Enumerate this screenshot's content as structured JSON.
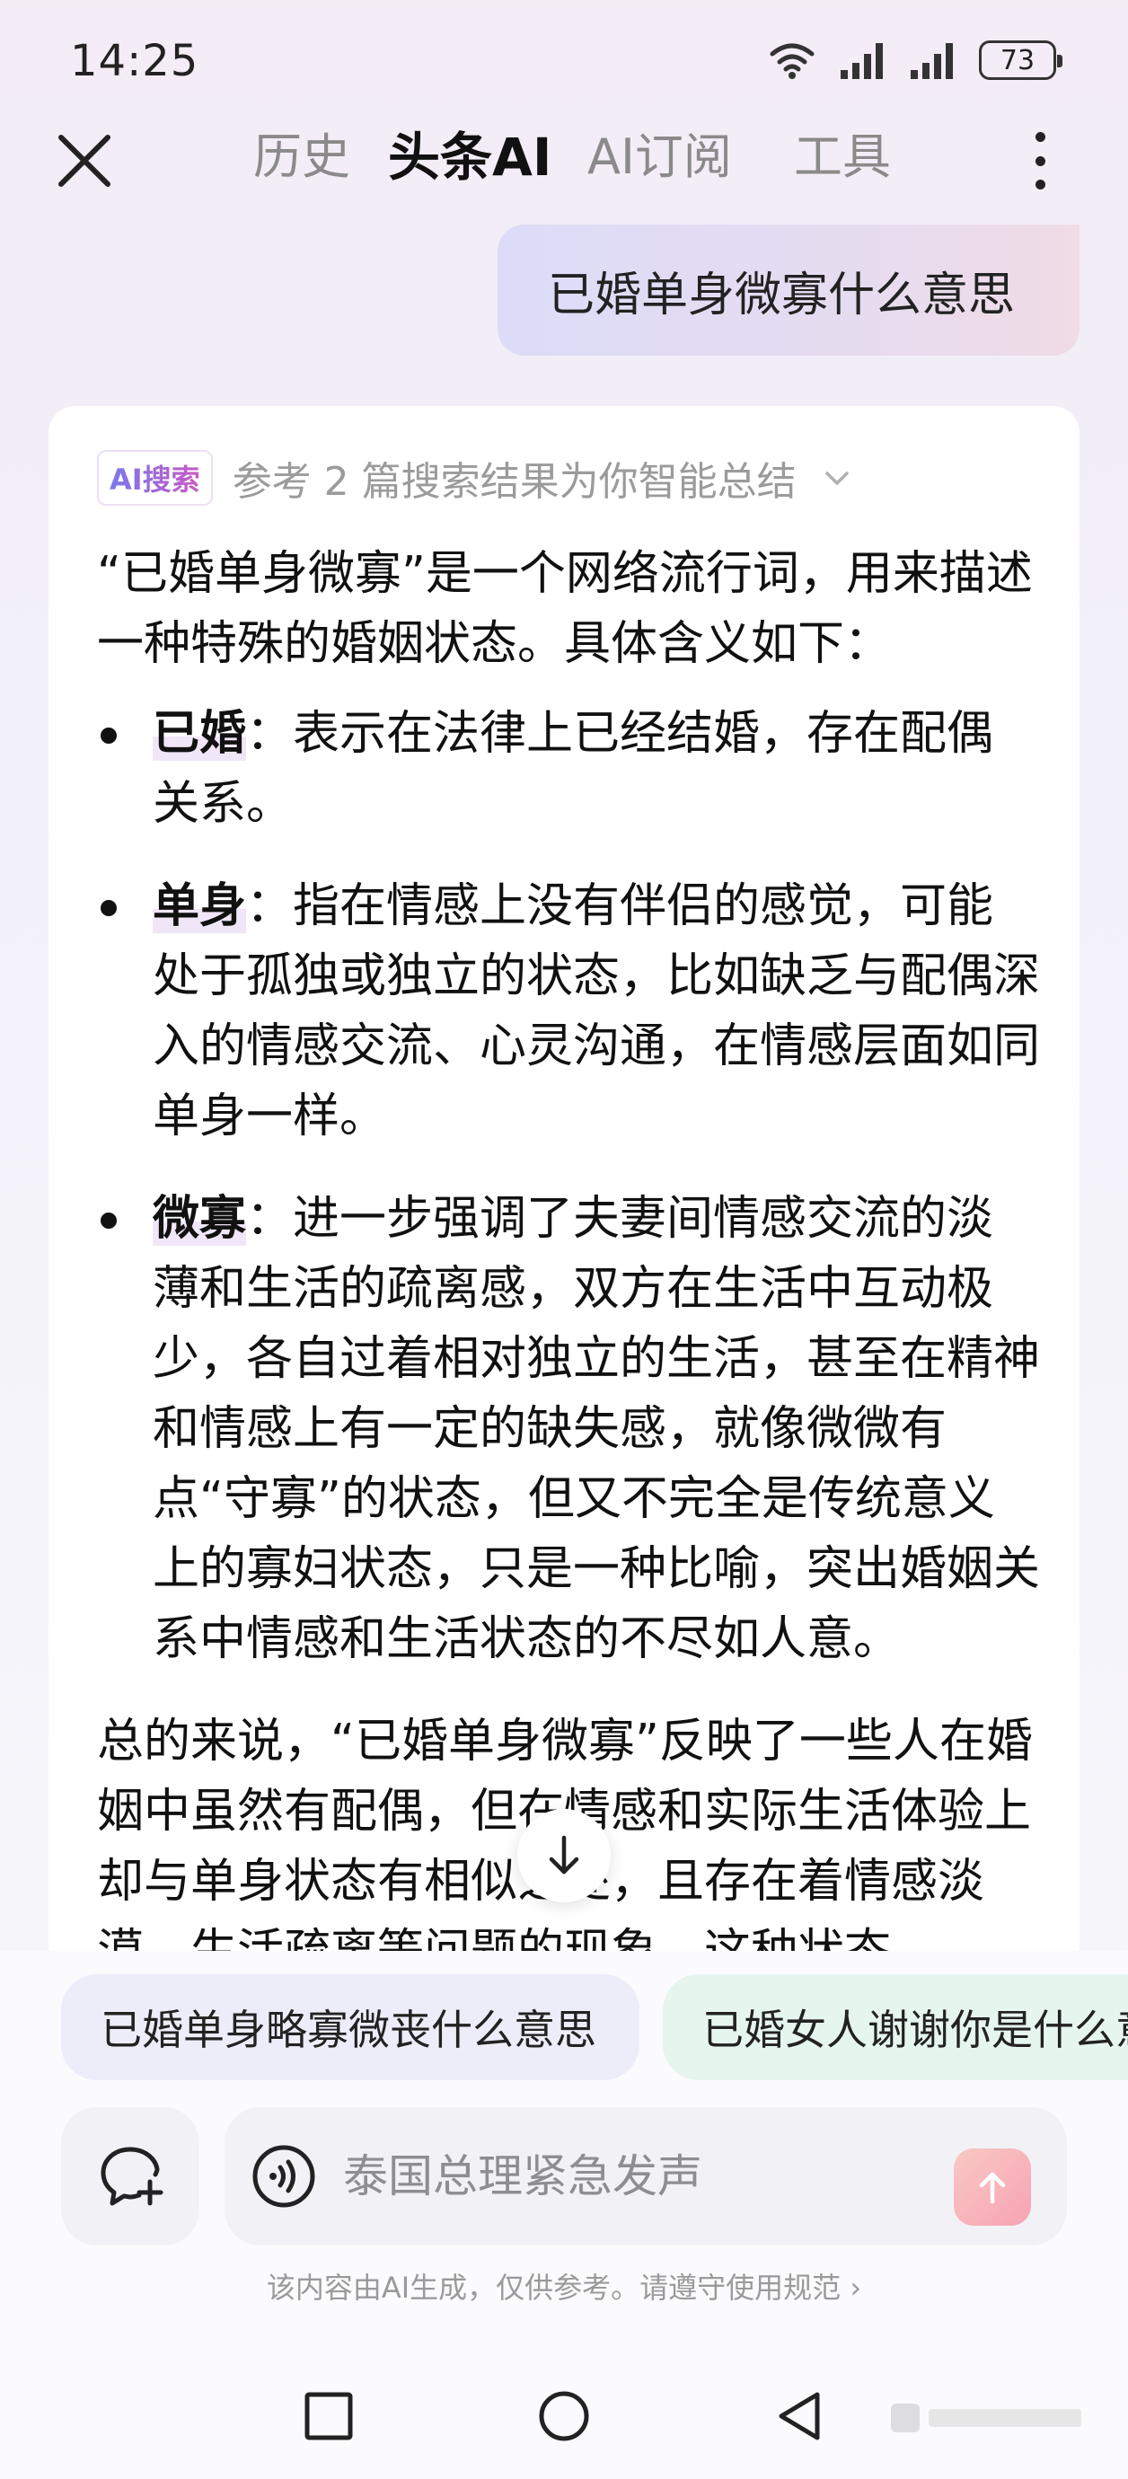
{
  "status_bar": {
    "time": "14:25",
    "battery": "73"
  },
  "nav": {
    "tabs": [
      {
        "label": "历史",
        "active": false
      },
      {
        "label": "头条AI",
        "active": true
      },
      {
        "label": "AI订阅",
        "active": false
      },
      {
        "label": "工具",
        "active": false
      }
    ]
  },
  "query": "已婚单身微寡什么意思",
  "answer": {
    "badge": "AI搜索",
    "source_text": "参考 2 篇搜索结果为你智能总结",
    "intro": "“已婚单身微寡”是一个网络流行词，用来描述一种特殊的婚姻状态。具体含义如下：",
    "items": [
      {
        "term": "已婚",
        "desc": "：表示在法律上已经结婚，存在配偶关系。"
      },
      {
        "term": "单身",
        "desc": "：指在情感上没有伴侣的感觉，可能处于孤独或独立的状态，比如缺乏与配偶深入的情感交流、心灵沟通，在情感层面如同单身一样。"
      },
      {
        "term": "微寡",
        "desc": "：进一步强调了夫妻间情感交流的淡薄和生活的疏离感，双方在生活中互动极少，各自过着相对独立的生活，甚至在精神和情感上有一定的缺失感，就像微微有点“守寡”的状态，但又不完全是传统意义上的寡妇状态，只是一种比喻，突出婚姻关系中情感和生活状态的不尽如人意。"
      }
    ],
    "summary": "总的来说，“已婚单身微寡”反映了一些人在婚姻中虽然有配偶，但在情感和实际生活体验上却与单身状态有相似之处，且存在着情感淡漠、生活疏离等问题的现象。这种状态"
  },
  "suggestions": [
    "已婚单身略寡微丧什么意思",
    "已婚女人谢谢你是什么意思"
  ],
  "input": {
    "placeholder": "泰国总理紧急发声"
  },
  "disclaimer": "该内容由AI生成，仅供参考。请遵守使用规范 ›",
  "colors": {
    "accent_gradient_start": "#6f7df0",
    "accent_gradient_end": "#d255c0",
    "send_button": "#f7a3b3"
  }
}
